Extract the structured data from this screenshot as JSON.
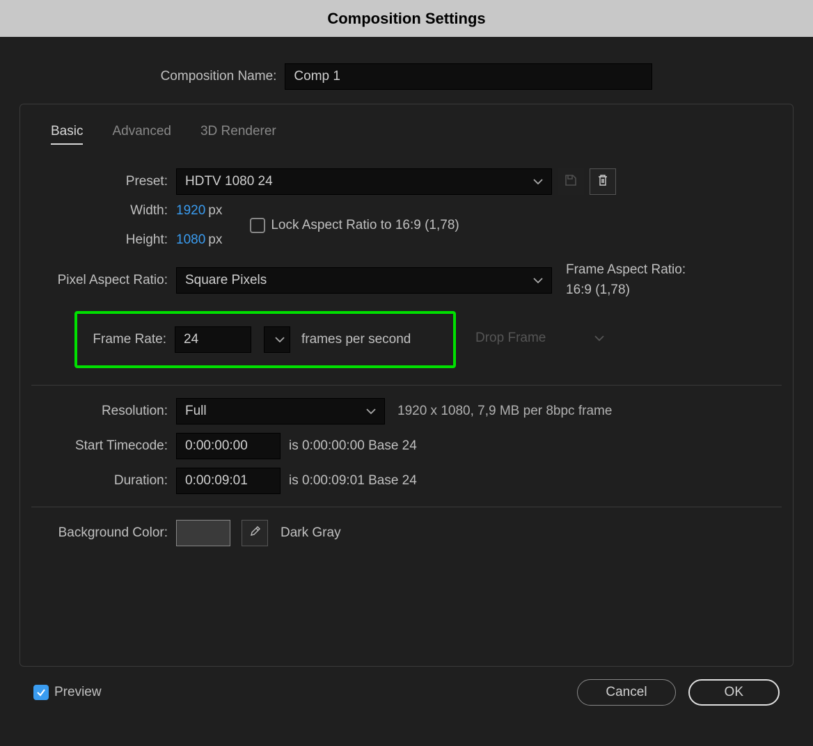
{
  "dialog": {
    "title": "Composition Settings"
  },
  "composition": {
    "name_label": "Composition Name:",
    "name_value": "Comp 1"
  },
  "tabs": {
    "basic": "Basic",
    "advanced": "Advanced",
    "renderer": "3D Renderer"
  },
  "preset": {
    "label": "Preset:",
    "value": "HDTV 1080 24"
  },
  "dimensions": {
    "width_label": "Width:",
    "width_value": "1920",
    "height_label": "Height:",
    "height_value": "1080",
    "px": "px",
    "lock_label": "Lock Aspect Ratio to 16:9 (1,78)"
  },
  "par": {
    "label": "Pixel Aspect Ratio:",
    "value": "Square Pixels"
  },
  "far": {
    "label": "Frame Aspect Ratio:",
    "value": "16:9 (1,78)"
  },
  "framerate": {
    "label": "Frame Rate:",
    "value": "24",
    "unit": "frames per second",
    "dropframe": "Drop Frame"
  },
  "resolution": {
    "label": "Resolution:",
    "value": "Full",
    "hint": "1920 x 1080, 7,9 MB per 8bpc frame"
  },
  "start_tc": {
    "label": "Start Timecode:",
    "value": "0:00:00:00",
    "hint": "is 0:00:00:00  Base 24"
  },
  "duration": {
    "label": "Duration:",
    "value": "0:00:09:01",
    "hint": "is 0:00:09:01  Base 24"
  },
  "bg": {
    "label": "Background Color:",
    "name": "Dark Gray"
  },
  "footer": {
    "preview": "Preview",
    "cancel": "Cancel",
    "ok": "OK"
  }
}
